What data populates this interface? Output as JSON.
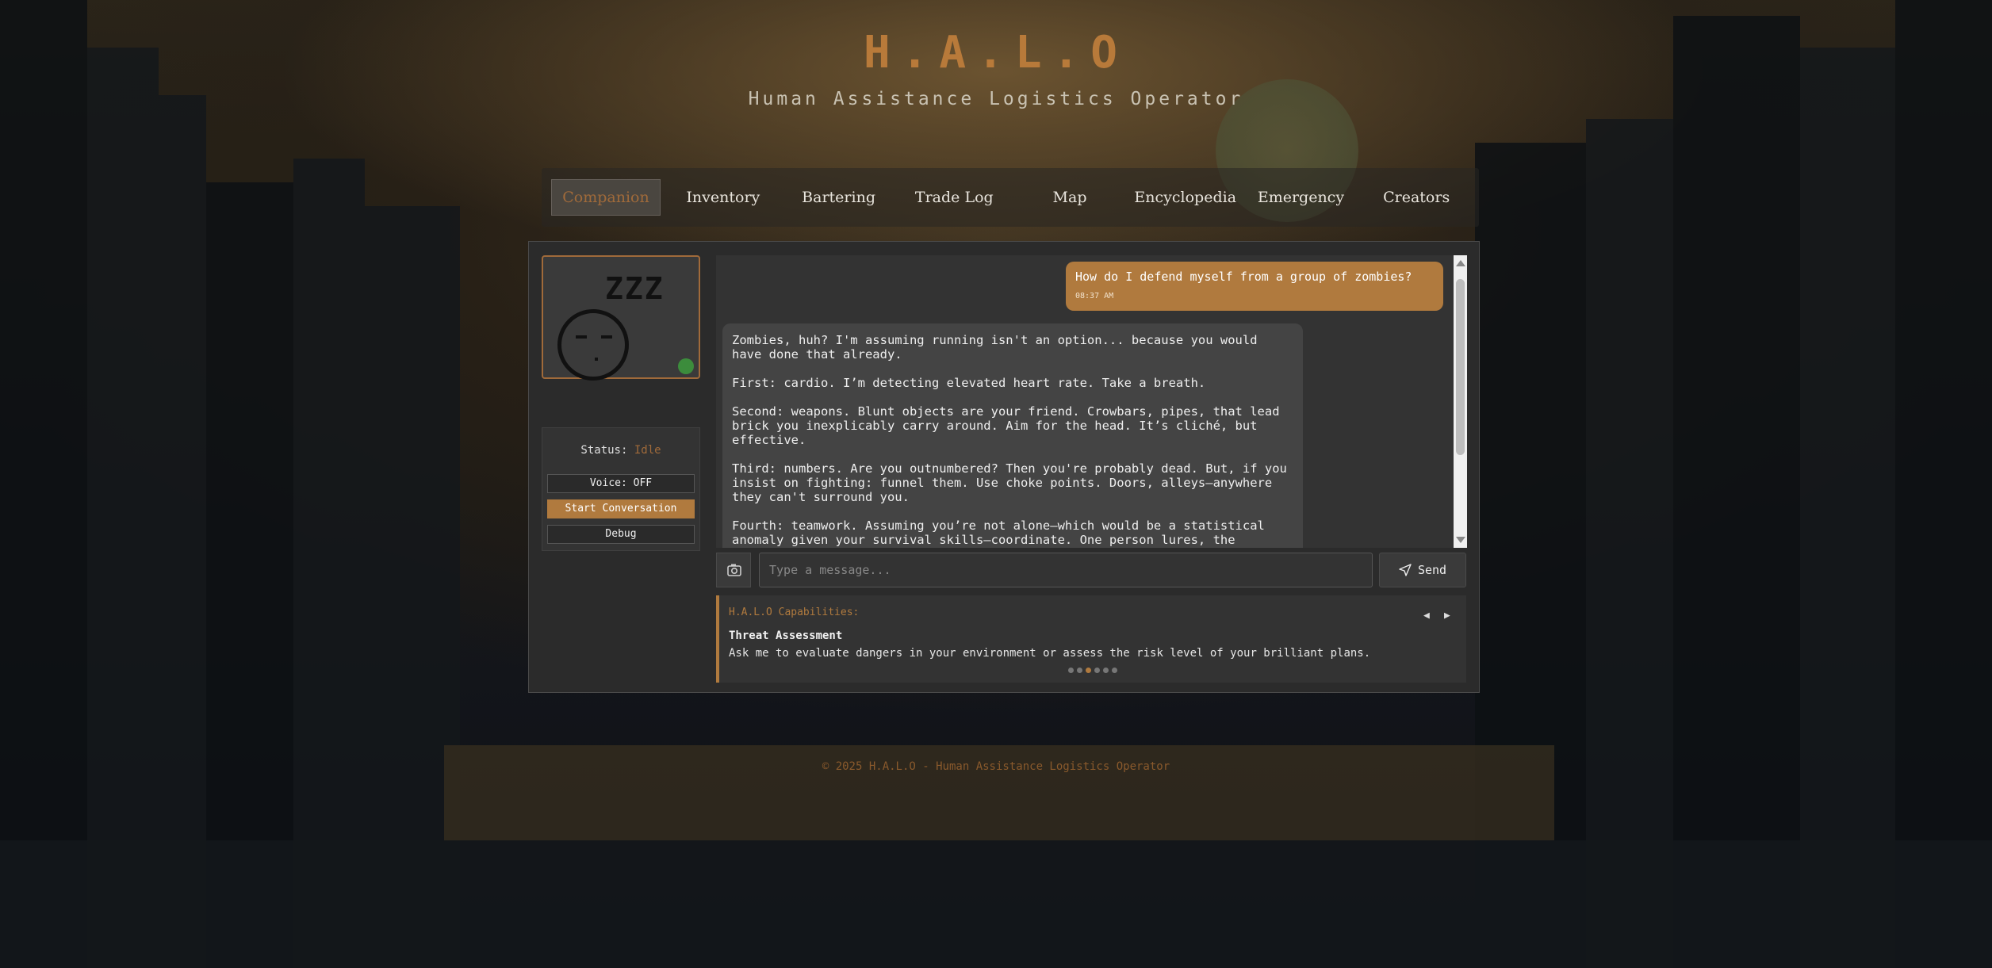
{
  "header": {
    "title": "H.A.L.O",
    "subtitle": "Human Assistance Logistics Operator"
  },
  "nav": {
    "tabs": [
      {
        "label": "Companion",
        "active": true
      },
      {
        "label": "Inventory",
        "active": false
      },
      {
        "label": "Bartering",
        "active": false
      },
      {
        "label": "Trade Log",
        "active": false
      },
      {
        "label": "Map",
        "active": false
      },
      {
        "label": "Encyclopedia",
        "active": false
      },
      {
        "label": "Emergency",
        "active": false
      },
      {
        "label": "Creators",
        "active": false
      }
    ]
  },
  "companion": {
    "sleep_text": "ZZZ",
    "status_label": "Status:",
    "status_value": "Idle",
    "voice_button": "Voice: OFF",
    "start_button": "Start Conversation",
    "debug_button": "Debug"
  },
  "chat": {
    "user_message": {
      "text": "How do I defend myself from a group of zombies?",
      "time": "08:37 AM"
    },
    "bot_message": {
      "paragraphs": [
        "Zombies, huh? I'm assuming running isn't an option... because you would have done that already.",
        "First: cardio. I’m detecting elevated heart rate. Take a breath.",
        "Second: weapons. Blunt objects are your friend. Crowbars, pipes, that lead brick you inexplicably carry around. Aim for the head. It’s cliché, but effective.",
        "Third: numbers. Are you outnumbered? Then you're probably dead. But, if you insist on fighting: funnel them. Use choke points. Doors, alleys—anywhere they can't surround you.",
        "Fourth: teamwork. Assuming you’re not alone—which would be a statistical anomaly given your survival skills—coordinate. One person lures, the"
      ]
    },
    "input_placeholder": "Type a message...",
    "send_label": "Send"
  },
  "capabilities": {
    "heading": "H.A.L.O Capabilities:",
    "title": "Threat Assessment",
    "description": "Ask me to evaluate dangers in your environment or assess the risk level of your brilliant plans.",
    "prev_symbol": "◀",
    "next_symbol": "▶",
    "page_count": 6,
    "active_page": 3
  },
  "footer": {
    "text": "© 2025 H.A.L.O - Human Assistance Logistics Operator"
  },
  "colors": {
    "accent": "#b07a3e",
    "title": "#b87a3a",
    "status_online": "#3c8c3c"
  }
}
